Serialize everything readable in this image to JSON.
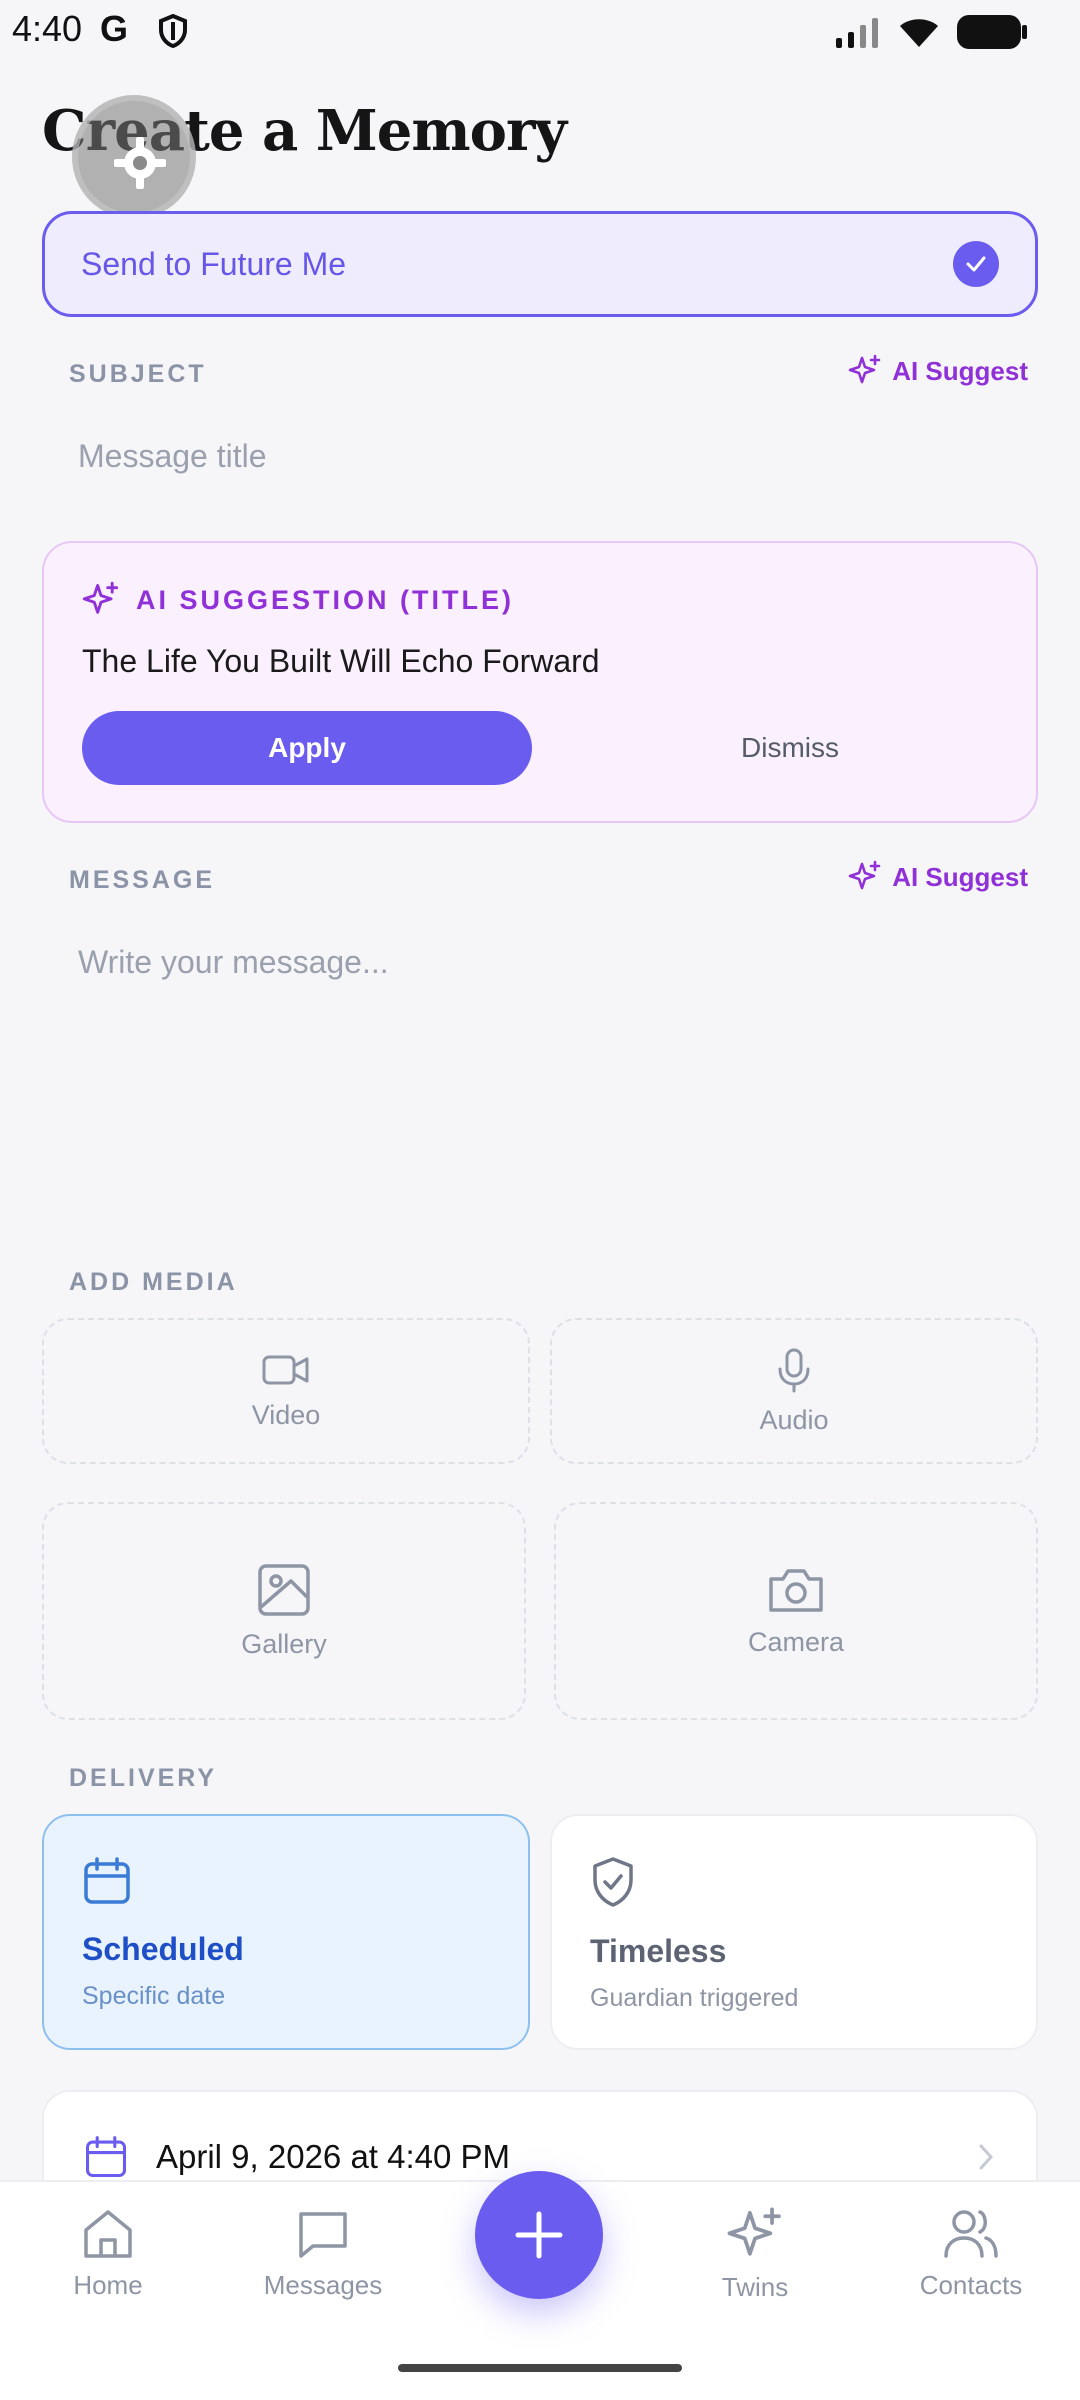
{
  "status_bar": {
    "time": "4:40",
    "g_letter": "G"
  },
  "page_title": "Create a Memory",
  "recipient": {
    "label": "Send to Future Me"
  },
  "subject": {
    "section_label": "SUBJECT",
    "ai_suggest": "AI Suggest",
    "placeholder": "Message title"
  },
  "suggestion": {
    "heading": "AI SUGGESTION (TITLE)",
    "text": "The Life You Built Will Echo Forward",
    "apply": "Apply",
    "dismiss": "Dismiss"
  },
  "message": {
    "section_label": "MESSAGE",
    "ai_suggest": "AI Suggest",
    "placeholder": "Write your message..."
  },
  "media": {
    "section_label": "ADD MEDIA",
    "items": [
      {
        "label": "Video",
        "icon": "video-icon"
      },
      {
        "label": "Audio",
        "icon": "mic-icon"
      },
      {
        "label": "Gallery",
        "icon": "image-icon"
      },
      {
        "label": "Camera",
        "icon": "camera-icon"
      }
    ]
  },
  "delivery": {
    "section_label": "DELIVERY",
    "options": [
      {
        "title": "Scheduled",
        "subtitle": "Specific date",
        "selected": true,
        "icon": "calendar-icon"
      },
      {
        "title": "Timeless",
        "subtitle": "Guardian triggered",
        "selected": false,
        "icon": "shield-check-icon"
      }
    ],
    "date": "April 9, 2026 at 4:40 PM"
  },
  "nav": {
    "items": [
      {
        "label": "Home",
        "icon": "home-icon"
      },
      {
        "label": "Messages",
        "icon": "message-icon"
      },
      {
        "label": "Twins",
        "icon": "sparkles-icon"
      },
      {
        "label": "Contacts",
        "icon": "users-icon"
      }
    ]
  },
  "colors": {
    "accent": "#6b5cf0",
    "ai_purple": "#9031d8",
    "scheduled_blue": "#1f4fc6",
    "muted": "#8e95a4"
  }
}
